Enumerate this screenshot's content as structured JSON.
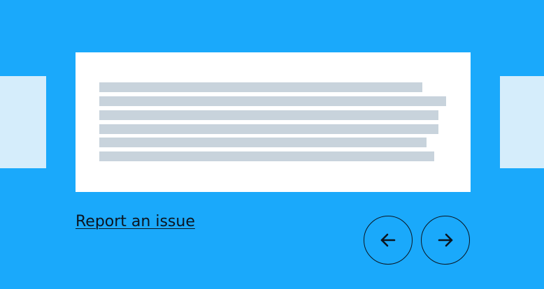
{
  "carousel": {
    "placeholder_lines": [
      462,
      496,
      485,
      485,
      468,
      479
    ],
    "colors": {
      "background": "#1aa9fb",
      "side_card": "#d5edfb",
      "card": "#ffffff",
      "line": "#c8d3dc",
      "ink": "#0b1520"
    }
  },
  "footer": {
    "report_label": "Report an issue"
  },
  "nav": {
    "prev_icon": "arrow-left-icon",
    "next_icon": "arrow-right-icon"
  }
}
